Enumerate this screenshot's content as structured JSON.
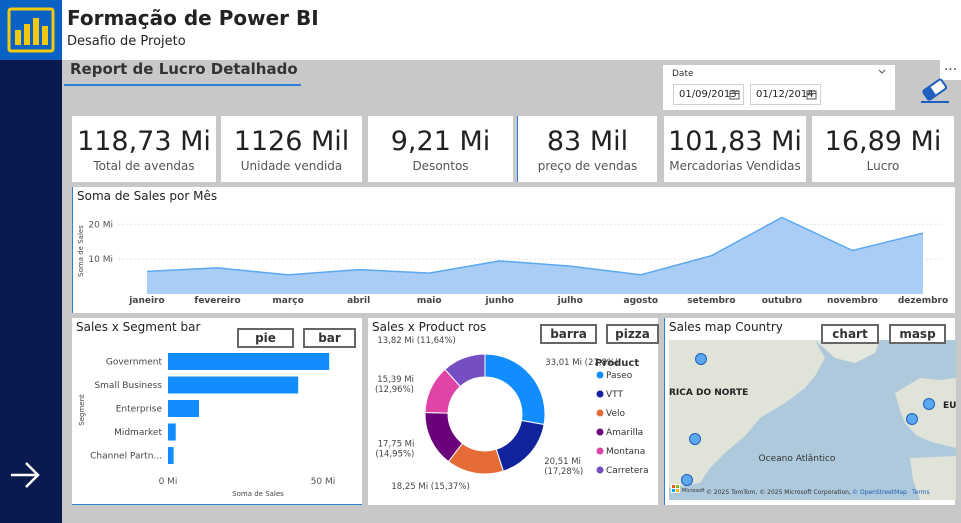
{
  "header": {
    "title": "Formação de Power BI",
    "subtitle": "Desafio de Projeto"
  },
  "report": {
    "title": "Report de Lucro Detalhado"
  },
  "date_slicer": {
    "label": "Date",
    "from": "01/09/2013",
    "to": "01/12/2014"
  },
  "more_label": "...",
  "kpis": [
    {
      "value": "118,73 Mi",
      "label": "Total de avendas"
    },
    {
      "value": "1126 Mil",
      "label": "Unidade vendida"
    },
    {
      "value": "9,21 Mi",
      "label": "Desontos"
    },
    {
      "value": "83 Mil",
      "label": "preço de vendas"
    },
    {
      "value": "101,83 Mi",
      "label": "Mercadorias Vendidas"
    },
    {
      "value": "16,89 Mi",
      "label": "Lucro"
    }
  ],
  "colors": {
    "accent": "#118dff",
    "area_fill": "#a9cdf5",
    "area_line": "#5ba7f0",
    "nav": "#0b1a4e",
    "logo_bg": "#0a62c4",
    "logo_bars": "#f2c811"
  },
  "chart_data": [
    {
      "type": "area",
      "title": "Soma de Sales por Mês",
      "ylabel": "Soma de Sales",
      "xlabel": "",
      "y_ticks": [
        "20 Mi",
        "10 Mi"
      ],
      "y_tick_values": [
        20,
        10
      ],
      "ylim": [
        0,
        25
      ],
      "categories": [
        "janeiro",
        "fevereiro",
        "março",
        "abril",
        "maio",
        "junho",
        "julho",
        "agosto",
        "setembro",
        "outubro",
        "novembro",
        "dezembro"
      ],
      "values": [
        6.5,
        7.5,
        5.5,
        7,
        6,
        9.5,
        8,
        5.5,
        11,
        22,
        12.5,
        17.5
      ]
    },
    {
      "type": "bar",
      "title": "Sales x Segment bar",
      "ylabel": "Segment",
      "xlabel": "Soma de Sales",
      "x_ticks": [
        "0 Mi",
        "50 Mi"
      ],
      "x_tick_values": [
        0,
        50
      ],
      "xlim": [
        0,
        60
      ],
      "categories": [
        "Government",
        "Small Business",
        "Enterprise",
        "Midmarket",
        "Channel Partn..."
      ],
      "values": [
        52,
        42,
        10,
        2.5,
        1.8
      ],
      "buttons": [
        "pie",
        "bar"
      ]
    },
    {
      "type": "pie",
      "title": "Sales x Product ros",
      "legend_title": "Product",
      "slices": [
        {
          "name": "Paseo",
          "label": "33,01 Mi (27,8%)",
          "value": 33.01,
          "color": "#118dff"
        },
        {
          "name": "VTT",
          "label": "20,51 Mi (17,28%)",
          "value": 20.51,
          "color": "#12239e"
        },
        {
          "name": "Velo",
          "label": "18,25 Mi (15,37%)",
          "value": 18.25,
          "color": "#e66c37"
        },
        {
          "name": "Amarilla",
          "label": "17,75 Mi (14,95%)",
          "value": 17.75,
          "color": "#6b007b"
        },
        {
          "name": "Montana",
          "label": "15,39 Mi (12,96%)",
          "value": 15.39,
          "color": "#e044a7"
        },
        {
          "name": "Carretera",
          "label": "13,82 Mi (11,64%)",
          "value": 13.82,
          "color": "#744ec2"
        }
      ],
      "buttons": [
        "barra",
        "pizza"
      ]
    }
  ],
  "map": {
    "title": "Sales map Country",
    "buttons": [
      "chart",
      "masp"
    ],
    "labels": {
      "north_america": "RICA DO NORTE",
      "ocean": "Oceano Atlântico",
      "europe": "EU"
    },
    "attribution": "© 2025 TomTom, © 2025 Microsoft Corporation,",
    "osm": "© OpenStreetMap",
    "terms": "Terms",
    "brand": "Microsoft"
  }
}
